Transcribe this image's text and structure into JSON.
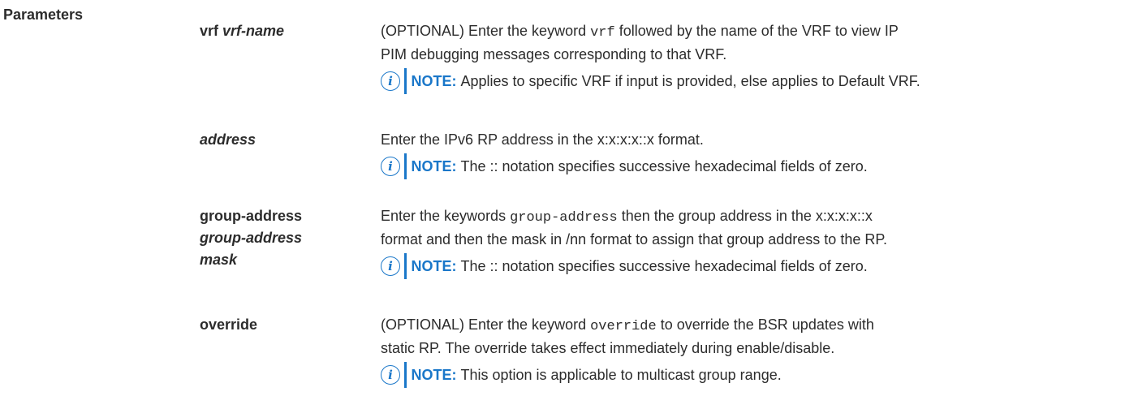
{
  "section": {
    "label": "Parameters"
  },
  "params": [
    {
      "name_parts": [
        "vrf",
        "vrf-name"
      ],
      "desc_lines": [
        [
          "(OPTIONAL) Enter the keyword ",
          "vrf",
          " followed by the name of the VRF to view IP"
        ],
        "PIM debugging messages corresponding to that VRF."
      ],
      "note_label": "NOTE:",
      "note_text": "Applies to specific VRF if input is provided, else applies to Default VRF."
    },
    {
      "name_parts": [
        "address"
      ],
      "desc_lines": [
        "Enter the IPv6 RP address in the x:x:x:x::x format."
      ],
      "note_label": "NOTE:",
      "note_text": "The :: notation specifies successive hexadecimal fields of zero."
    },
    {
      "name_parts": [
        "group-address",
        "group-address",
        "mask"
      ],
      "desc_lines": [
        [
          "Enter the keywords ",
          "group-address",
          " then the group address in the x:x:x:x::x"
        ],
        "format and then the mask in /nn format to assign that group address to the RP."
      ],
      "note_label": "NOTE:",
      "note_text": "The :: notation specifies successive hexadecimal fields of zero."
    },
    {
      "name_parts": [
        "override"
      ],
      "desc_lines": [
        [
          "(OPTIONAL) Enter the keyword ",
          "override",
          " to override the BSR updates with"
        ],
        "static RP. The override takes effect immediately during enable/disable."
      ],
      "note_label": "NOTE:",
      "note_text": "This option is applicable to multicast group range."
    }
  ],
  "icons": {
    "note": "info-icon"
  },
  "colors": {
    "accent": "#1a77c9",
    "text": "#2c2c2c"
  }
}
